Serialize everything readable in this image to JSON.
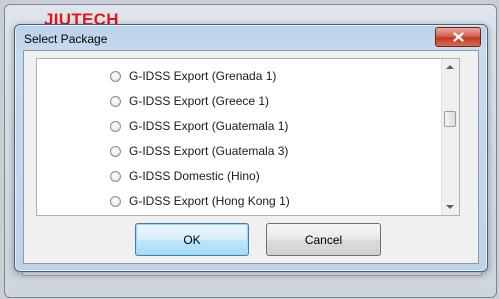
{
  "watermark": "JIUTECH",
  "dialog": {
    "title": "Select Package",
    "close_icon": "close-icon"
  },
  "list": {
    "items": [
      {
        "label": "G-IDSS Export (Grenada 1)",
        "selected": false
      },
      {
        "label": "G-IDSS Export (Greece 1)",
        "selected": false
      },
      {
        "label": "G-IDSS Export (Guatemala 1)",
        "selected": false
      },
      {
        "label": "G-IDSS Export (Guatemala 3)",
        "selected": false
      },
      {
        "label": "G-IDSS Domestic (Hino)",
        "selected": false
      },
      {
        "label": "G-IDSS Export (Hong Kong 1)",
        "selected": false
      }
    ]
  },
  "buttons": {
    "ok_label": "OK",
    "cancel_label": "Cancel"
  }
}
